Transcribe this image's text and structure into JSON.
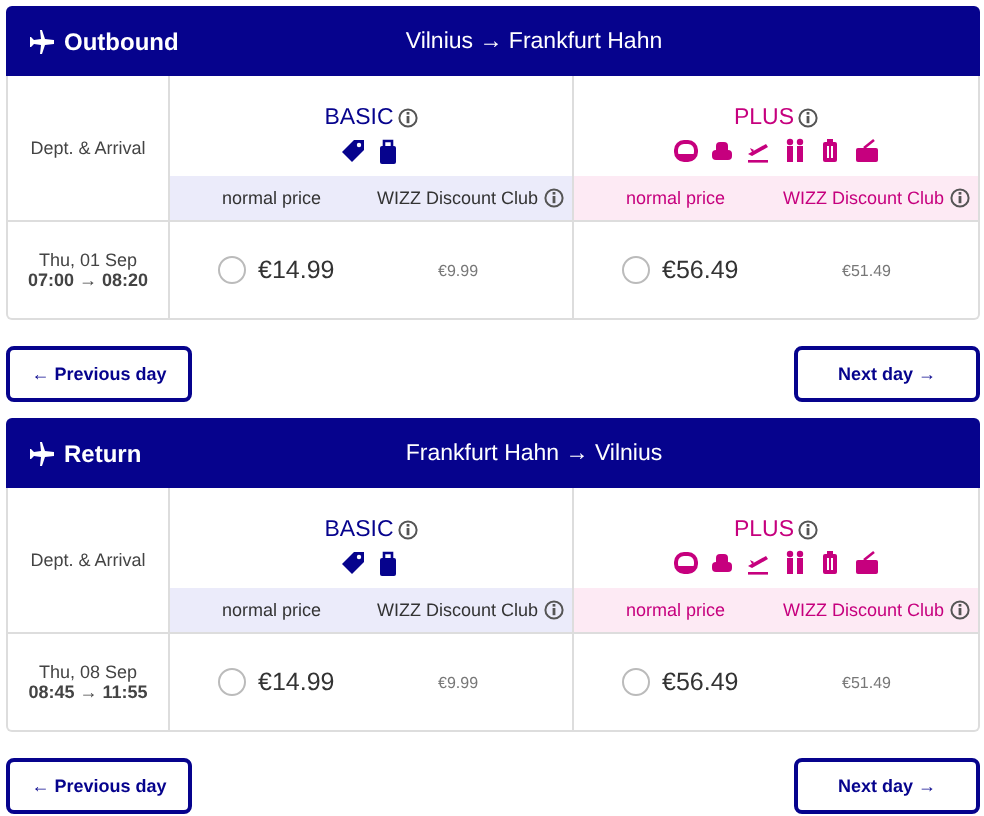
{
  "sections": [
    {
      "title": "Outbound",
      "route": "Vilnius → Frankfurt Hahn",
      "dept_label": "Dept. & Arrival",
      "fares": [
        {
          "kind": "basic",
          "name": "BASIC",
          "normal_label": "normal price",
          "club_label": "WIZZ Discount Club",
          "price": "€14.99",
          "club_price": "€9.99",
          "selected": false
        },
        {
          "kind": "plus",
          "name": "PLUS",
          "normal_label": "normal price",
          "club_label": "WIZZ Discount Club",
          "price": "€56.49",
          "club_price": "€51.49",
          "selected": false
        }
      ],
      "date": "Thu, 01 Sep",
      "times": "07:00 → 08:20",
      "prev": "← Previous day",
      "next": "Next day →"
    },
    {
      "title": "Return",
      "route": "Frankfurt Hahn → Vilnius",
      "dept_label": "Dept. & Arrival",
      "fares": [
        {
          "kind": "basic",
          "name": "BASIC",
          "normal_label": "normal price",
          "club_label": "WIZZ Discount Club",
          "price": "€14.99",
          "club_price": "€9.99",
          "selected": false
        },
        {
          "kind": "plus",
          "name": "PLUS",
          "normal_label": "normal price",
          "club_label": "WIZZ Discount Club",
          "price": "€56.49",
          "club_price": "€51.49",
          "selected": false
        }
      ],
      "date": "Thu, 08 Sep",
      "times": "08:45 → 11:55",
      "prev": "← Previous day",
      "next": "Next day →"
    }
  ]
}
